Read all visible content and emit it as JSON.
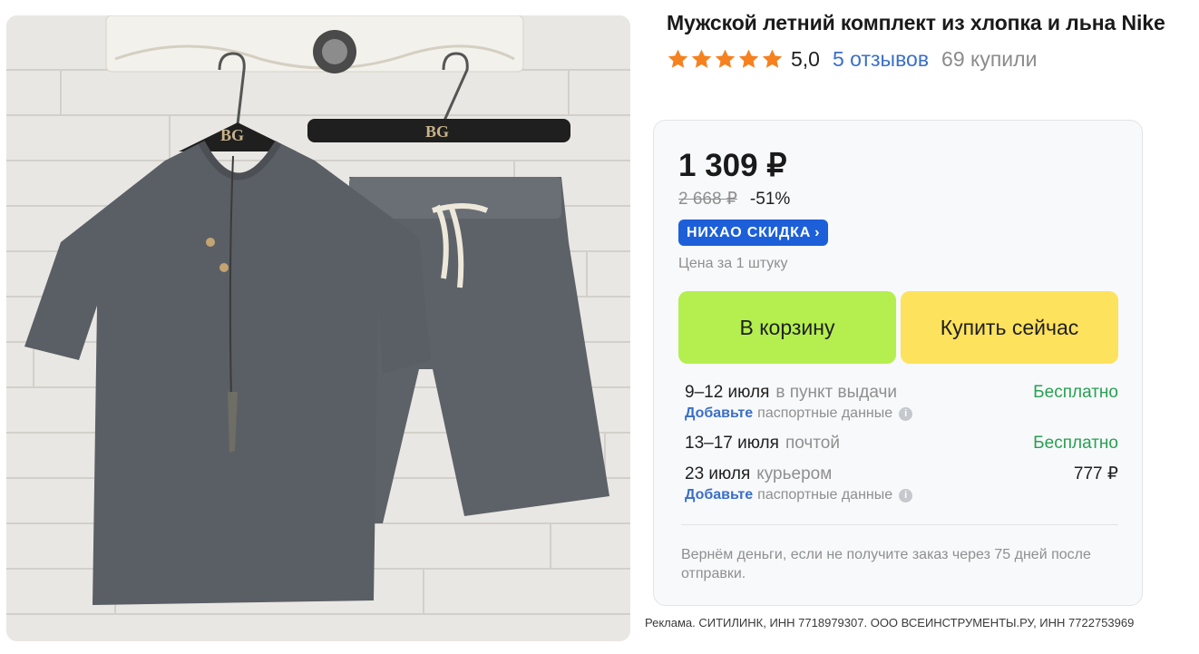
{
  "product": {
    "title": "Мужской летний комплект из хлопка и льна Nike",
    "hanger_label": "BG",
    "rating": {
      "value": "5,0",
      "stars": 5,
      "reviews_link": "5 отзывов",
      "bought": "69 купили"
    }
  },
  "pricing": {
    "price": "1 309 ₽",
    "old_price": "2 668 ₽",
    "discount": "-51%",
    "promo_badge": "НИХАО СКИДКА",
    "unit_note": "Цена за 1 штуку"
  },
  "actions": {
    "cart_label": "В корзину",
    "buy_now_label": "Купить сейчас"
  },
  "delivery": [
    {
      "date": "9–12 июля",
      "method": "в пункт выдачи",
      "cost": "Бесплатно",
      "free": true,
      "note_link": "Добавьте",
      "note_text": "паспортные данные"
    },
    {
      "date": "13–17 июля",
      "method": "почтой",
      "cost": "Бесплатно",
      "free": true
    },
    {
      "date": "23 июля",
      "method": "курьером",
      "cost": "777 ₽",
      "free": false,
      "note_link": "Добавьте",
      "note_text": "паспортные данные"
    }
  ],
  "guarantee": "Вернём деньги, если не получите заказ через 75 дней после отправки.",
  "ad_note": "Реклама. СИТИЛИНК, ИНН 7718979307. ООО ВСЕИНСТРУМЕНТЫ.РУ, ИНН 7722753969",
  "colors": {
    "accent_blue": "#3a6fc8",
    "promo_blue": "#1c5fd9",
    "cart_green": "#b4ef4f",
    "buy_yellow": "#fde25d",
    "free_green": "#27a152",
    "star_orange": "#f5811f"
  },
  "icons": [
    "star-icon",
    "chevron-right-icon",
    "info-icon"
  ]
}
